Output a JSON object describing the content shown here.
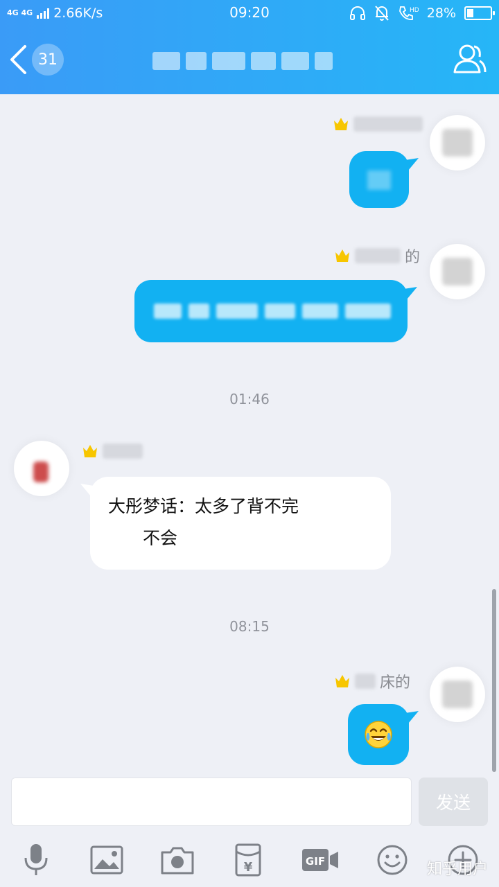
{
  "status_bar": {
    "network": "4G 4G",
    "speed": "2.66K/s",
    "time": "09:20",
    "battery": "28%",
    "battery_level": 0.28
  },
  "header": {
    "unread_count": "31",
    "chat_title": "",
    "profile_icon": "group-profile-icon"
  },
  "messages": {
    "m1": {
      "sender_suffix": ""
    },
    "m2": {
      "sender_suffix": "的"
    },
    "time_1": "01:46",
    "m3": {
      "text_line1": "大彤梦话：太多了背不完",
      "text_line2": "不会"
    },
    "time_2": "08:15",
    "m4": {
      "sender_suffix": "床的",
      "emoji": "😂"
    }
  },
  "input": {
    "value": "",
    "placeholder": "",
    "send_label": "发送"
  },
  "toolbar": {
    "gif_label": "GIF",
    "yen_label": "¥",
    "icons": [
      "microphone-icon",
      "image-icon",
      "camera-icon",
      "red-packet-icon",
      "gif-icon",
      "emoji-icon",
      "plus-icon"
    ]
  },
  "watermark": "知乎用户",
  "colors": {
    "header_start": "#3a9bf7",
    "header_end": "#26b6f7",
    "bubble_out": "#12b1f2",
    "chat_bg": "#eef0f6",
    "crown": "#f7c600"
  }
}
